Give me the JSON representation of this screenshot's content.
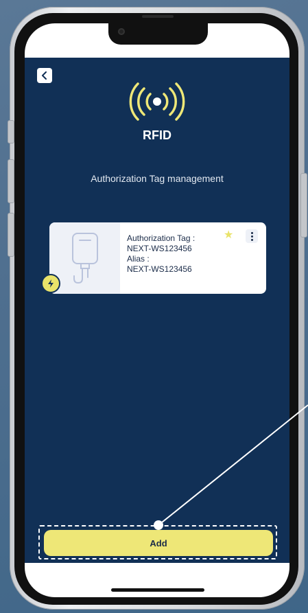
{
  "app": {
    "header": {
      "back_icon": "chevron-left-icon",
      "title": "RFID",
      "rfid_icon": "rfid-signal-icon"
    },
    "section_title": "Authorization Tag management",
    "tags": [
      {
        "auth_tag_label": "Authorization Tag :",
        "auth_tag_value": "NEXT-WS123456",
        "alias_label": "Alias :",
        "alias_value": "NEXT-WS123456",
        "favorite": true,
        "status_icon": "lightning-icon",
        "image_icon": "wall-charger-icon",
        "menu_icon": "more-vertical-icon"
      }
    ],
    "add_button_label": "Add"
  },
  "colors": {
    "app_background": "#113056",
    "accent_yellow": "#eee777",
    "text_dark": "#1a2b48"
  }
}
